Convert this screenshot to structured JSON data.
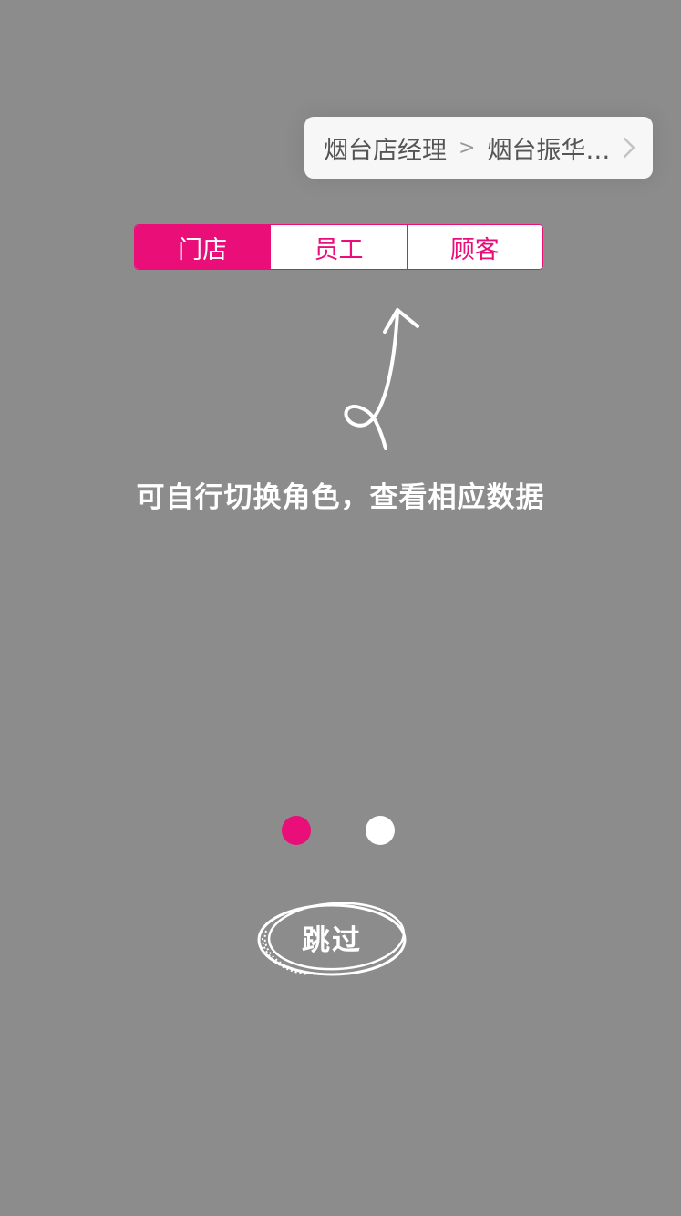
{
  "breadcrumb": {
    "role": "烟台店经理",
    "separator": ">",
    "store": "烟台振华…",
    "chevron_icon": "chevron-right-icon"
  },
  "role_tabs": {
    "active_index": 0,
    "tabs": [
      {
        "label": "门店"
      },
      {
        "label": "员工"
      },
      {
        "label": "顾客"
      }
    ]
  },
  "hint": {
    "text": "可自行切换角色，查看相应数据",
    "arrow_icon": "curly-arrow-up-icon"
  },
  "pager": {
    "current": 1,
    "total": 2
  },
  "skip": {
    "label": "跳过"
  },
  "colors": {
    "accent": "#e90e78",
    "overlay": "#8c8c8c",
    "card": "#f7f7f7",
    "white": "#ffffff"
  }
}
